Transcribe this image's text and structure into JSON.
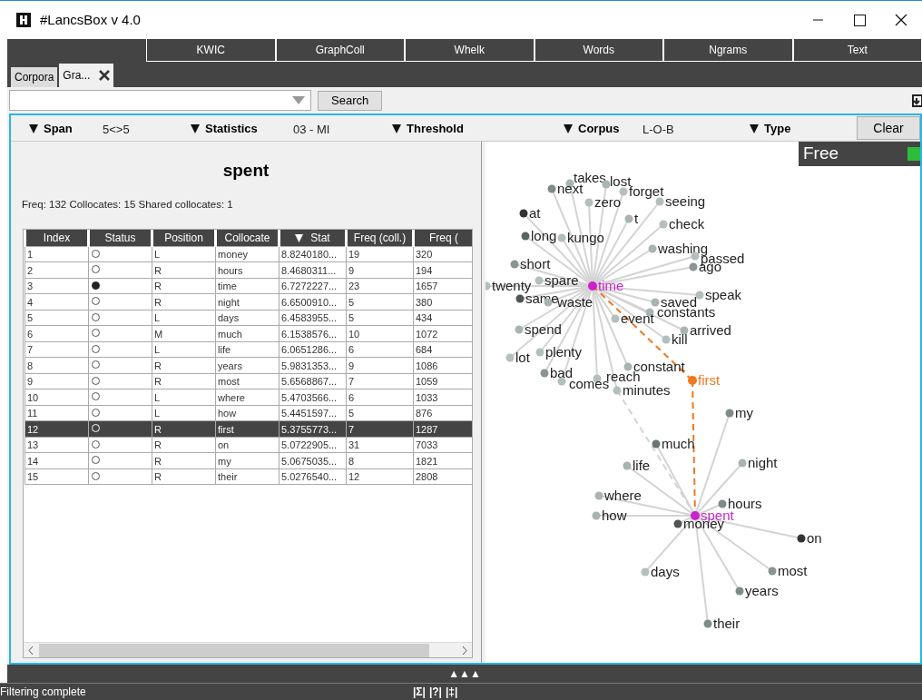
{
  "window": {
    "title": "#LancsBox v 4.0"
  },
  "tools": [
    {
      "label": "KWIC"
    },
    {
      "label": "GraphColl"
    },
    {
      "label": "Whelk"
    },
    {
      "label": "Words"
    },
    {
      "label": "Ngrams"
    },
    {
      "label": "Text"
    }
  ],
  "tabs": [
    {
      "label": "Corpora",
      "selected": false,
      "closable": false
    },
    {
      "label": "Gra...",
      "selected": true,
      "closable": true
    }
  ],
  "search": {
    "button": "Search"
  },
  "filters": [
    {
      "label": "Span",
      "value": "5<>5"
    },
    {
      "label": "Statistics",
      "value": "03 - MI"
    },
    {
      "label": "Threshold"
    },
    {
      "label": "Corpus",
      "value": "L-O-B"
    },
    {
      "label": "Type"
    }
  ],
  "clear_button": "Clear",
  "node_title": "spent",
  "summary": "Freq: 132 Collocates: 15 Shared collocates: 1",
  "table": {
    "columns": [
      "Index",
      "Status",
      "Position",
      "Collocate",
      "Stat",
      "Freq (coll.)",
      "Freq ("
    ],
    "rows": [
      {
        "cells": [
          "1",
          "",
          "L",
          "money",
          "8.8240180...",
          "19",
          "320"
        ],
        "shared": false,
        "selected": false
      },
      {
        "cells": [
          "2",
          "",
          "R",
          "hours",
          "8.4680311...",
          "9",
          "194"
        ],
        "shared": false,
        "selected": false
      },
      {
        "cells": [
          "3",
          "",
          "R",
          "time",
          "6.7272227...",
          "23",
          "1657"
        ],
        "shared": true,
        "selected": false
      },
      {
        "cells": [
          "4",
          "",
          "R",
          "night",
          "6.6500910...",
          "5",
          "380"
        ],
        "shared": false,
        "selected": false
      },
      {
        "cells": [
          "5",
          "",
          "L",
          "days",
          "6.4583955...",
          "5",
          "434"
        ],
        "shared": false,
        "selected": false
      },
      {
        "cells": [
          "6",
          "",
          "M",
          "much",
          "6.1538576...",
          "10",
          "1072"
        ],
        "shared": false,
        "selected": false
      },
      {
        "cells": [
          "7",
          "",
          "L",
          "life",
          "6.0651286...",
          "6",
          "684"
        ],
        "shared": false,
        "selected": false
      },
      {
        "cells": [
          "8",
          "",
          "R",
          "years",
          "5.9831353...",
          "9",
          "1086"
        ],
        "shared": false,
        "selected": false
      },
      {
        "cells": [
          "9",
          "",
          "R",
          "most",
          "5.6568867...",
          "7",
          "1059"
        ],
        "shared": false,
        "selected": false
      },
      {
        "cells": [
          "10",
          "",
          "L",
          "where",
          "5.4703566...",
          "6",
          "1033"
        ],
        "shared": false,
        "selected": false
      },
      {
        "cells": [
          "11",
          "",
          "L",
          "how",
          "5.4451597...",
          "5",
          "876"
        ],
        "shared": false,
        "selected": false
      },
      {
        "cells": [
          "12",
          "",
          "R",
          "first",
          "5.3755773...",
          "7",
          "1287"
        ],
        "shared": false,
        "selected": true
      },
      {
        "cells": [
          "13",
          "",
          "R",
          "on",
          "5.0722905...",
          "31",
          "7033"
        ],
        "shared": false,
        "selected": false
      },
      {
        "cells": [
          "14",
          "",
          "R",
          "my",
          "5.0675035...",
          "8",
          "1821"
        ],
        "shared": false,
        "selected": false
      },
      {
        "cells": [
          "15",
          "",
          "R",
          "their",
          "5.0276540...",
          "12",
          "2808"
        ],
        "shared": false,
        "selected": false
      }
    ]
  },
  "graph": {
    "badge": "Free",
    "upper_cluster": {
      "hub": {
        "label": "time",
        "color": "#cc22cc"
      },
      "collocates": [
        {
          "label": "takes",
          "color": "#a9b3b3",
          "kind": "plain"
        },
        {
          "label": "lost",
          "color": "#a9b3b3",
          "kind": "plain"
        },
        {
          "label": "next",
          "color": "#7f8a8a",
          "kind": "plain"
        },
        {
          "label": "forget",
          "color": "#b4bebe",
          "kind": "plain"
        },
        {
          "label": "zero",
          "color": "#b4bebe",
          "kind": "plain"
        },
        {
          "label": "seeing",
          "color": "#b4bebe",
          "kind": "plain"
        },
        {
          "label": "at",
          "color": "#333333",
          "kind": "plain"
        },
        {
          "label": "t",
          "color": "#a9b3b3",
          "kind": "plain"
        },
        {
          "label": "check",
          "color": "#b4bebe",
          "kind": "plain"
        },
        {
          "label": "long",
          "color": "#5c6262",
          "kind": "plain"
        },
        {
          "label": "kungo",
          "color": "#b4bebe",
          "kind": "plain"
        },
        {
          "label": "washing",
          "color": "#a9b3b3",
          "kind": "plain"
        },
        {
          "label": "passed",
          "color": "#b4bebe",
          "kind": "plain"
        },
        {
          "label": "ago",
          "color": "#8a9494",
          "kind": "plain"
        },
        {
          "label": "short",
          "color": "#8a9494",
          "kind": "plain"
        },
        {
          "label": "spare",
          "color": "#b4bebe",
          "kind": "plain"
        },
        {
          "label": "twenty",
          "color": "#b4bebe",
          "kind": "plain"
        },
        {
          "label": "same",
          "color": "#4f5555",
          "kind": "plain"
        },
        {
          "label": "waste",
          "color": "#a9b3b3",
          "kind": "plain"
        },
        {
          "label": "speak",
          "color": "#b4bebe",
          "kind": "plain"
        },
        {
          "label": "saved",
          "color": "#a9b3b3",
          "kind": "plain"
        },
        {
          "label": "constants",
          "color": "#a9b3b3",
          "kind": "plain"
        },
        {
          "label": "event",
          "color": "#b4bebe",
          "kind": "plain"
        },
        {
          "label": "arrived",
          "color": "#a9b3b3",
          "kind": "plain"
        },
        {
          "label": "kill",
          "color": "#b4bebe",
          "kind": "plain"
        },
        {
          "label": "spend",
          "color": "#a9b3b3",
          "kind": "plain"
        },
        {
          "label": "plenty",
          "color": "#b4bebe",
          "kind": "plain"
        },
        {
          "label": "lot",
          "color": "#b4bebe",
          "kind": "plain"
        },
        {
          "label": "constant",
          "color": "#a9b3b3",
          "kind": "plain"
        },
        {
          "label": "bad",
          "color": "#8a9494",
          "kind": "plain"
        },
        {
          "label": "reach",
          "color": "#b4bebe",
          "kind": "plain"
        },
        {
          "label": "comes",
          "color": "#b4bebe",
          "kind": "plain"
        },
        {
          "label": "minutes",
          "color": "#b4bebe",
          "kind": "cross_linked"
        }
      ]
    },
    "shared": [
      {
        "label": "first",
        "color": "#f07820"
      }
    ],
    "lower_cluster": {
      "hub": {
        "label": "spent",
        "color": "#cc22cc"
      },
      "collocates": [
        {
          "label": "my",
          "color": "#7f8a8a",
          "kind": "plain"
        },
        {
          "label": "much",
          "color": "#6b7373",
          "kind": "plain"
        },
        {
          "label": "night",
          "color": "#a9b3b3",
          "kind": "plain"
        },
        {
          "label": "life",
          "color": "#a9b3b3",
          "kind": "plain"
        },
        {
          "label": "where",
          "color": "#a9b3b3",
          "kind": "plain"
        },
        {
          "label": "hours",
          "color": "#7f8a8a",
          "kind": "plain"
        },
        {
          "label": "how",
          "color": "#a9b3b3",
          "kind": "plain"
        },
        {
          "label": "money",
          "color": "#4f5555",
          "kind": "plain"
        },
        {
          "label": "on",
          "color": "#333333",
          "kind": "plain"
        },
        {
          "label": "days",
          "color": "#b4bebe",
          "kind": "plain"
        },
        {
          "label": "most",
          "color": "#8a9494",
          "kind": "plain"
        },
        {
          "label": "years",
          "color": "#7f8a8a",
          "kind": "plain"
        },
        {
          "label": "their",
          "color": "#7f8a8a",
          "kind": "plain"
        }
      ]
    }
  },
  "splitter": "▲▲▲",
  "status_bar": {
    "message": "Filtering complete",
    "tools": [
      "|Σ|",
      "|?|",
      "|‡|"
    ]
  }
}
